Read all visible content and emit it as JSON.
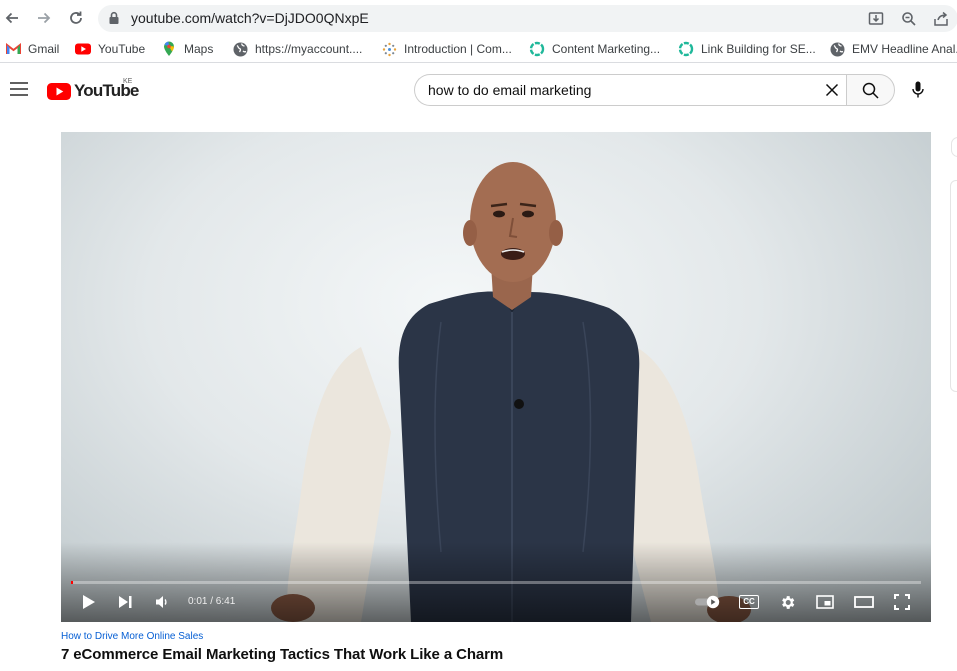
{
  "browser": {
    "url": "youtube.com/watch?v=DjJDO0QNxpE"
  },
  "bookmarks": [
    {
      "label": "Gmail",
      "icon": "gmail-icon"
    },
    {
      "label": "YouTube",
      "icon": "youtube-icon"
    },
    {
      "label": "Maps",
      "icon": "maps-icon"
    },
    {
      "label": "https://myaccount....",
      "icon": "globe-icon"
    },
    {
      "label": "Introduction | Com...",
      "icon": "dotted-logo-icon"
    },
    {
      "label": "Content Marketing...",
      "icon": "ring-icon"
    },
    {
      "label": "Link Building for SE...",
      "icon": "ring-icon"
    },
    {
      "label": "EMV Headline Anal...",
      "icon": "globe-icon"
    }
  ],
  "youtube": {
    "logo_text": "YouTube",
    "country_code": "KE",
    "search_query": "how to do email marketing"
  },
  "player": {
    "current_time": "0:01",
    "duration": "6:41",
    "time_display": "0:01 / 6:41",
    "progress_fraction": 0.0025,
    "captions_label": "CC"
  },
  "video": {
    "channel_link": "How to Drive More Online Sales",
    "title": "7 eCommerce Email Marketing Tactics That Work Like a Charm"
  },
  "colors": {
    "youtube_red": "#ff0000",
    "link_blue": "#065fd4"
  }
}
